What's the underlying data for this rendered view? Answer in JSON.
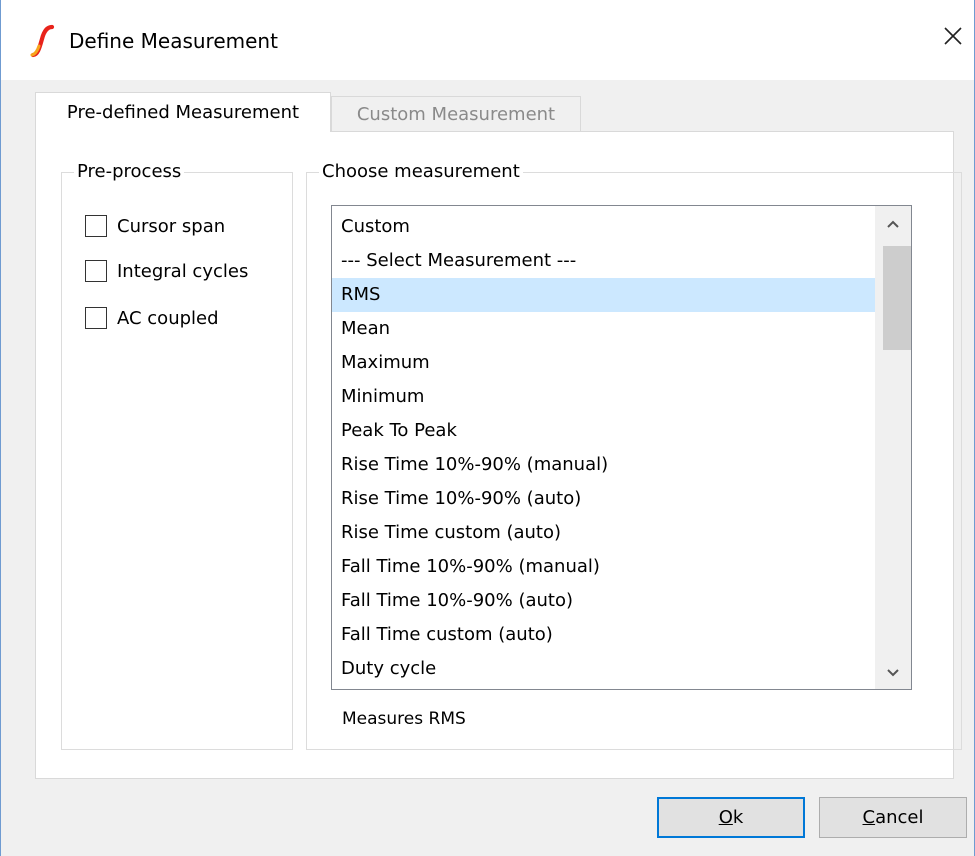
{
  "window": {
    "title": "Define Measurement",
    "close_glyph": "✕",
    "accent_color": "#0078d7"
  },
  "tabs": [
    {
      "label": "Pre-defined Measurement",
      "active": true
    },
    {
      "label": "Custom Measurement",
      "active": false
    }
  ],
  "preprocess": {
    "legend": "Pre-process",
    "options": [
      {
        "label": "Cursor span",
        "checked": false
      },
      {
        "label": "Integral cycles",
        "checked": false
      },
      {
        "label": "AC coupled",
        "checked": false
      }
    ]
  },
  "choose": {
    "legend": "Choose measurement",
    "items": [
      "Custom",
      "--- Select Measurement ---",
      "RMS",
      "Mean",
      "Maximum",
      "Minimum",
      "Peak To Peak",
      "Rise Time 10%-90% (manual)",
      "Rise Time 10%-90% (auto)",
      "Rise Time custom (auto)",
      "Fall Time 10%-90% (manual)",
      "Fall Time 10%-90% (auto)",
      "Fall Time custom (auto)",
      "Duty cycle"
    ],
    "selected_item": "RMS",
    "scroll_up_icon": "chevron-up-icon",
    "scroll_down_icon": "chevron-down-icon",
    "description": "Measures RMS"
  },
  "buttons": {
    "ok": {
      "mnemonic": "O",
      "rest": "k"
    },
    "cancel": {
      "mnemonic": "C",
      "rest": "ancel"
    }
  }
}
